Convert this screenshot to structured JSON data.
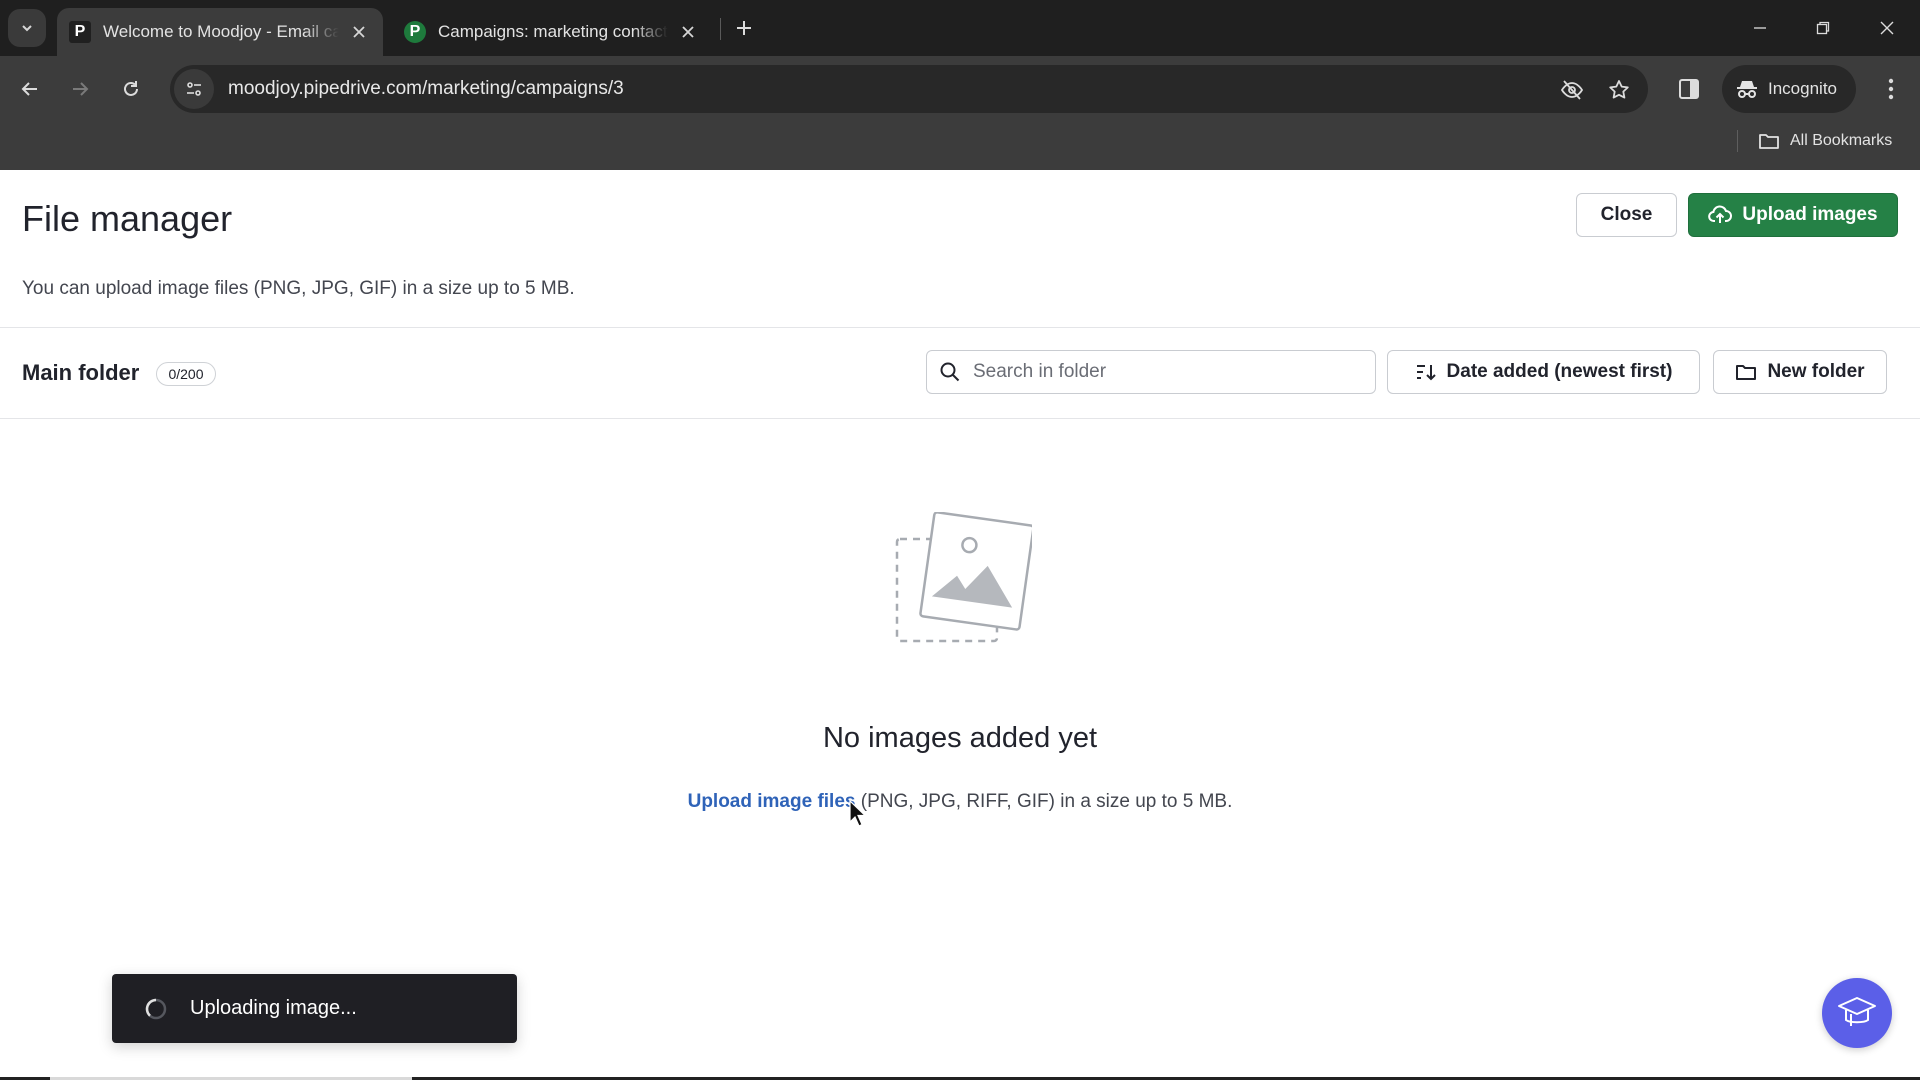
{
  "browser": {
    "tabs": [
      {
        "title": "Welcome to Moodjoy - Email campaigns",
        "favicon": "P",
        "active": true
      },
      {
        "title": "Campaigns: marketing contacts",
        "favicon": "P",
        "active": false
      }
    ],
    "url": "moodjoy.pipedrive.com/marketing/campaigns/3",
    "incognito_label": "Incognito",
    "all_bookmarks_label": "All Bookmarks"
  },
  "page": {
    "title": "File manager",
    "description": "You can upload image files (PNG, JPG, GIF) in a size up to 5 MB.",
    "close_label": "Close",
    "upload_label": "Upload images",
    "upload_color": "#258146"
  },
  "folder": {
    "name": "Main folder",
    "count": "0/200",
    "search_placeholder": "Search in folder",
    "sort_label": "Date added (newest first)",
    "new_folder_label": "New folder"
  },
  "empty_state": {
    "title": "No images added yet",
    "link_label": "Upload image files",
    "description_rest": " (PNG, JPG, RIFF, GIF) in a size up to 5 MB."
  },
  "toast": {
    "message": "Uploading image..."
  },
  "help": {
    "icon": "graduation-cap-icon",
    "color": "#5b5fe8"
  }
}
